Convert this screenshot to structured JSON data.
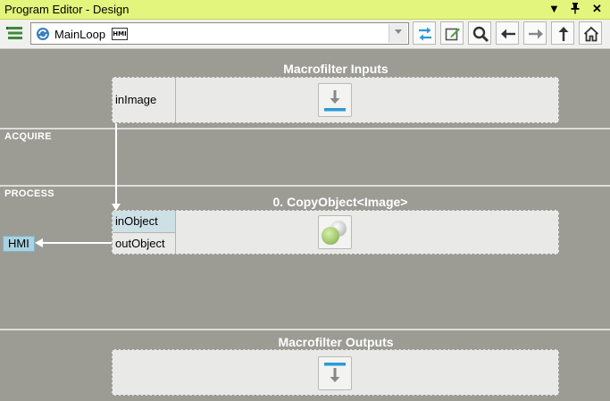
{
  "window": {
    "title": "Program Editor - Design",
    "controls": {
      "menu": "▼",
      "pin": "📌",
      "close": "✕"
    }
  },
  "toolbar": {
    "program_selector": {
      "value": "MainLoop",
      "badge": "HMI"
    }
  },
  "sections": {
    "acquire": "ACQUIRE",
    "process": "PROCESS"
  },
  "macro_inputs": {
    "title": "Macrofilter Inputs",
    "port": "inImage"
  },
  "filter": {
    "title": "0. CopyObject<Image>",
    "in_port": "inObject",
    "out_port": "outObject"
  },
  "hmi_tag": "HMI",
  "macro_outputs": {
    "title": "Macrofilter Outputs"
  },
  "colors": {
    "titlebar": "#e3f57c",
    "canvas": "#9c9c95",
    "accent_blue": "#2a9bd8",
    "port_highlight": "#cde0e6",
    "hmi_tag": "#a9d3e0"
  }
}
